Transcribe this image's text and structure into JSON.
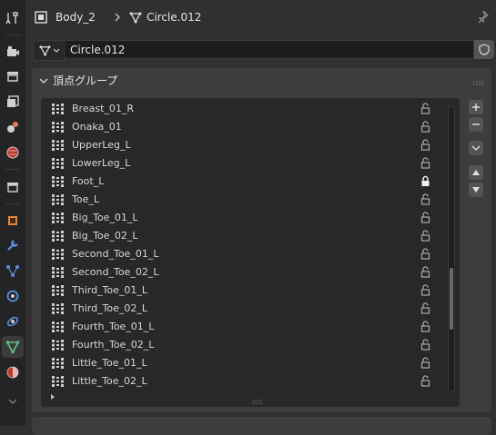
{
  "header": {
    "object_name": "Body_2",
    "mesh_name": "Circle.012"
  },
  "datablock": {
    "name": "Circle.012"
  },
  "panel": {
    "title": "頂点グループ"
  },
  "vertex_groups": [
    {
      "name": "Breast_01_R",
      "locked": false
    },
    {
      "name": "Onaka_01",
      "locked": false
    },
    {
      "name": "UpperLeg_L",
      "locked": false
    },
    {
      "name": "LowerLeg_L",
      "locked": false
    },
    {
      "name": "Foot_L",
      "locked": true
    },
    {
      "name": "Toe_L",
      "locked": false
    },
    {
      "name": "Big_Toe_01_L",
      "locked": false
    },
    {
      "name": "Big_Toe_02_L",
      "locked": false
    },
    {
      "name": "Second_Toe_01_L",
      "locked": false
    },
    {
      "name": "Second_Toe_02_L",
      "locked": false
    },
    {
      "name": "Third_Toe_01_L",
      "locked": false
    },
    {
      "name": "Third_Toe_02_L",
      "locked": false
    },
    {
      "name": "Fourth_Toe_01_L",
      "locked": false
    },
    {
      "name": "Fourth_Toe_02_L",
      "locked": false
    },
    {
      "name": "Little_Toe_01_L",
      "locked": false
    },
    {
      "name": "Little_Toe_02_L",
      "locked": false
    }
  ],
  "icons": {
    "tabs": [
      "tool-icon",
      "render-icon",
      "output-icon",
      "view-layer-icon",
      "scene-icon",
      "world-icon",
      "collection-icon",
      "object-icon",
      "modifier-icon",
      "particles-icon",
      "physics-icon",
      "constraints-icon",
      "mesh-data-icon",
      "material-icon"
    ],
    "active_tab": "mesh-data-icon"
  },
  "colors": {
    "accent_mesh": "#5ec28a",
    "object_orange": "#e8843a",
    "modifier_blue": "#5a8fe0"
  }
}
